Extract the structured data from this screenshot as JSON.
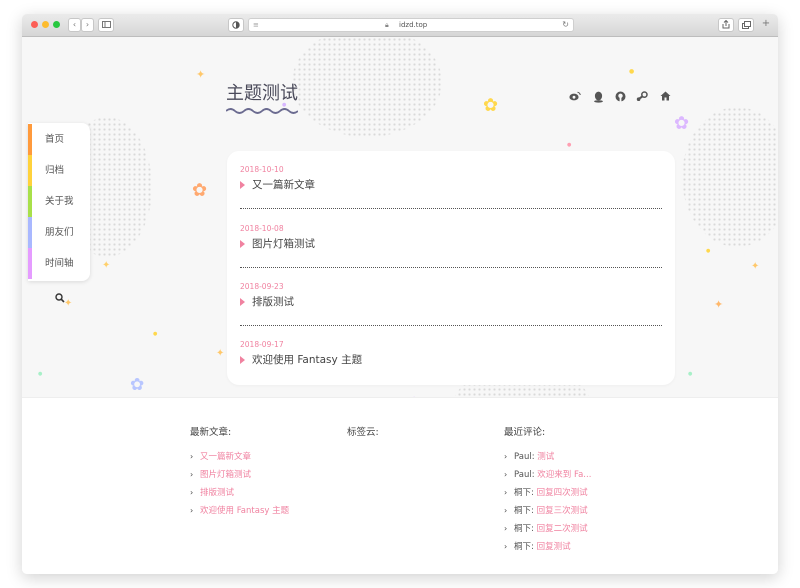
{
  "browser": {
    "url": "idzd.top",
    "nav_back": "‹",
    "nav_forward": "›"
  },
  "site": {
    "title": "主题测试"
  },
  "social_icons": [
    "weibo-icon",
    "qq-icon",
    "github-icon",
    "steam-icon",
    "home-icon"
  ],
  "nav": {
    "items": [
      {
        "label": "首页",
        "color": "#ff9a3c"
      },
      {
        "label": "归档",
        "color": "#ffd23c"
      },
      {
        "label": "关于我",
        "color": "#a8e04a"
      },
      {
        "label": "朋友们",
        "color": "#a9b8ff"
      },
      {
        "label": "时间轴",
        "color": "#e59cff"
      }
    ]
  },
  "posts": [
    {
      "date": "2018-10-10",
      "title": "又一篇新文章"
    },
    {
      "date": "2018-10-08",
      "title": "图片灯箱测试"
    },
    {
      "date": "2018-09-23",
      "title": "排版测试"
    },
    {
      "date": "2018-09-17",
      "title": "欢迎使用 Fantasy 主题"
    }
  ],
  "footer": {
    "latest": {
      "heading": "最新文章:",
      "items": [
        "又一篇新文章",
        "图片灯箱测试",
        "排版测试",
        "欢迎使用 Fantasy 主题"
      ]
    },
    "tags": {
      "heading": "标签云:"
    },
    "comments": {
      "heading": "最近评论:",
      "items": [
        {
          "author": "Paul:",
          "text": "测试"
        },
        {
          "author": "Paul:",
          "text": "欢迎来到 Fa..."
        },
        {
          "author": "桐下:",
          "text": "回复四次测试"
        },
        {
          "author": "桐下:",
          "text": "回复三次测试"
        },
        {
          "author": "桐下:",
          "text": "回复二次测试"
        },
        {
          "author": "桐下:",
          "text": "回复测试"
        }
      ]
    }
  },
  "colors": {
    "accent": "#f082a0",
    "title": "#4a4a5a",
    "wave": "#6b6b90"
  }
}
